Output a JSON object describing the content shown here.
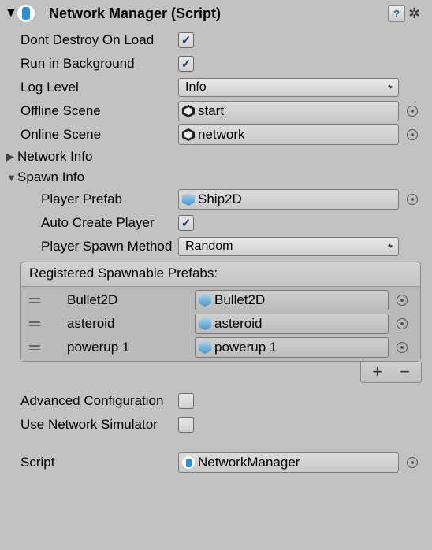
{
  "component": {
    "title": "Network Manager (Script)"
  },
  "props": {
    "dontDestroyOnLoad": {
      "label": "Dont Destroy On Load",
      "checked": true
    },
    "runInBackground": {
      "label": "Run in Background",
      "checked": true
    },
    "logLevel": {
      "label": "Log Level",
      "value": "Info"
    },
    "offlineScene": {
      "label": "Offline Scene",
      "value": "start"
    },
    "onlineScene": {
      "label": "Online Scene",
      "value": "network"
    },
    "networkInfo": {
      "label": "Network Info"
    },
    "spawnInfo": {
      "label": "Spawn Info"
    },
    "playerPrefab": {
      "label": "Player Prefab",
      "value": "Ship2D"
    },
    "autoCreatePlayer": {
      "label": "Auto Create Player",
      "checked": true
    },
    "playerSpawnMethod": {
      "label": "Player Spawn Method",
      "value": "Random"
    },
    "spawnablePrefabs": {
      "header": "Registered Spawnable Prefabs:",
      "items": [
        {
          "name": "Bullet2D",
          "ref": "Bullet2D"
        },
        {
          "name": "asteroid",
          "ref": "asteroid"
        },
        {
          "name": "powerup 1",
          "ref": "powerup 1"
        }
      ]
    },
    "advancedConfiguration": {
      "label": "Advanced Configuration",
      "checked": false
    },
    "useNetworkSimulator": {
      "label": "Use Network Simulator",
      "checked": false
    },
    "script": {
      "label": "Script",
      "value": "NetworkManager"
    }
  }
}
